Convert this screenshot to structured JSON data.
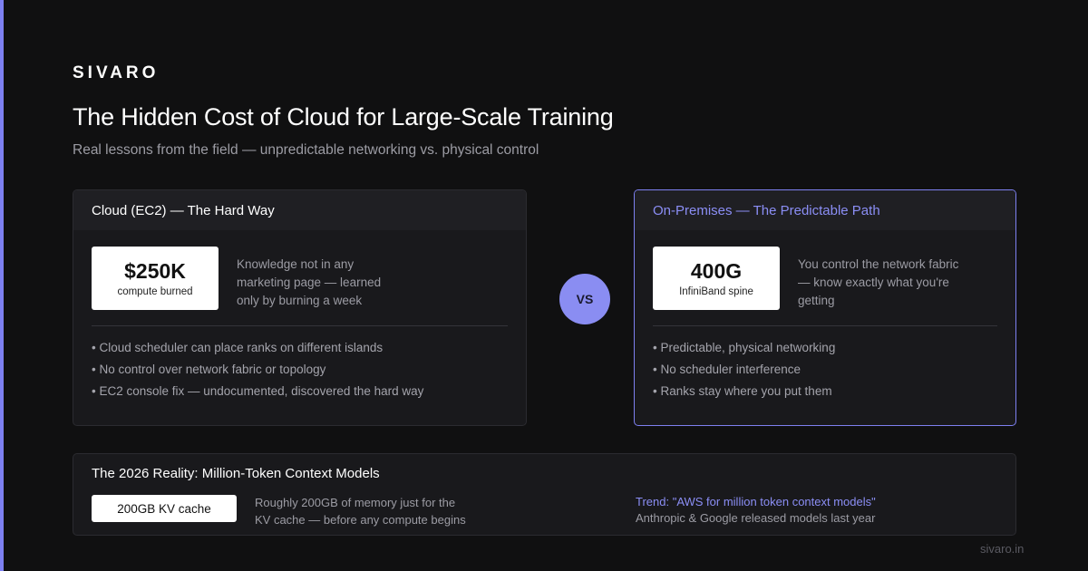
{
  "brand": "SIVARO",
  "title": "The Hidden Cost of Cloud for Large-Scale Training",
  "subtitle": "Real lessons from the field — unpredictable networking vs. physical control",
  "colors": {
    "accent": "#7d80f0",
    "background": "#101011",
    "card": "#19191c"
  },
  "cloud": {
    "header": "Cloud (EC2) — The Hard Way",
    "stat_value": "$250K",
    "stat_label": "compute burned",
    "stat_desc": "Knowledge not in any marketing page — learned only by burning a week",
    "bullets": [
      "• Cloud scheduler can place ranks on different islands",
      "• No control over network fabric or topology",
      "• EC2 console fix — undocumented, discovered the hard way"
    ]
  },
  "vs_label": "VS",
  "onprem": {
    "header": "On-Premises — The Predictable Path",
    "stat_value": "400G",
    "stat_label": "InfiniBand spine",
    "stat_desc": "You control the network fabric — know exactly what you're getting",
    "bullets": [
      "• Predictable, physical networking",
      "• No scheduler interference",
      "• Ranks stay where you put them"
    ]
  },
  "reality": {
    "title": "The 2026 Reality: Million-Token Context Models",
    "kv_label": "200GB KV cache",
    "kv_desc": "Roughly 200GB of memory just for the KV cache — before any compute begins",
    "trend": "Trend: \"AWS for million token context models\"",
    "trend_note": "Anthropic & Google released models last year"
  },
  "footer": "sivaro.in"
}
